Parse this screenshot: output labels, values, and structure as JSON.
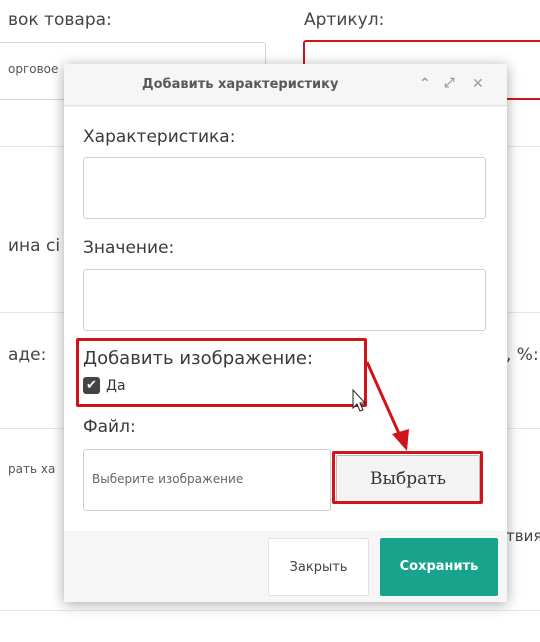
{
  "background": {
    "title_label": "вок товара:",
    "article_label": "Артикул:",
    "title_value": "орговое",
    "width_label": "ина сі",
    "price_label": "аде:",
    "percent_label": ", %:",
    "add_char_label": "рать ха",
    "availability_label": "твия"
  },
  "modal": {
    "title": "Добавить характеристику",
    "characteristic_label": "Характеристика:",
    "value_label": "Значение:",
    "add_image_label": "Добавить изображение:",
    "checkbox_label": "Да",
    "file_label": "Файл:",
    "file_placeholder": "Выберите изображение",
    "choose_button": "Выбрать",
    "close_button": "Закрыть",
    "save_button": "Сохранить"
  },
  "colors": {
    "highlight": "#d0141c",
    "save": "#18a38c"
  }
}
